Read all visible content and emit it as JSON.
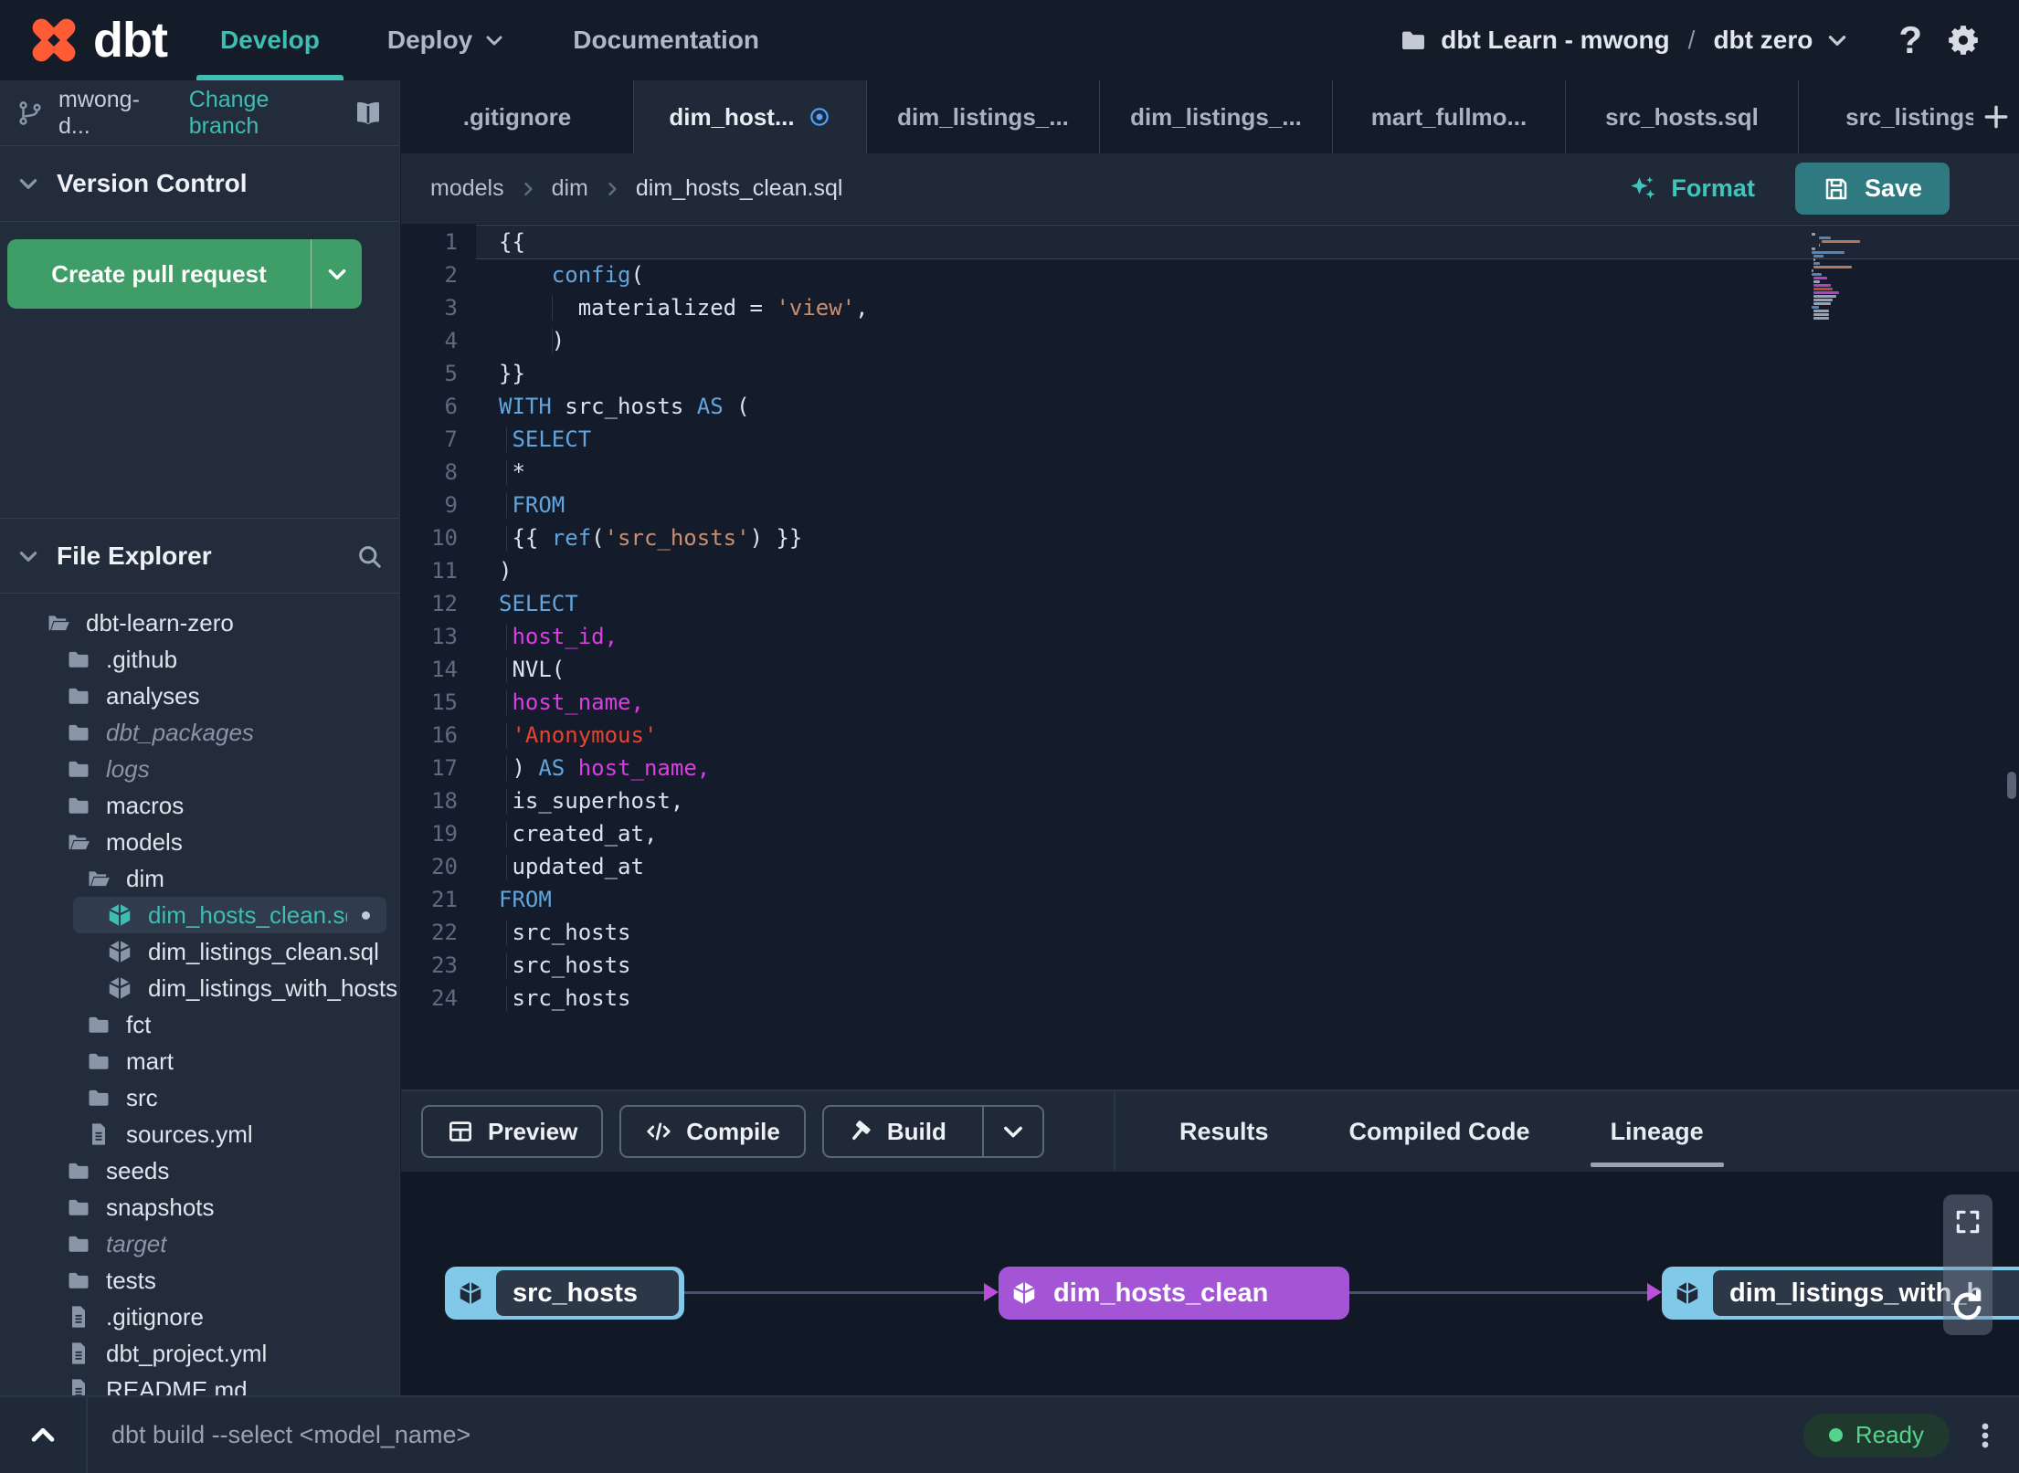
{
  "colors": {
    "accent_teal": "#3fbdb2",
    "teal_bright": "#3fc6bc",
    "create_pr_green": "#3f9e67",
    "save_teal": "#2e7a80",
    "node_purple": "#a355d6",
    "node_blue": "#82c8e8",
    "status_green": "#55d38a",
    "modified_dot_blue": "#4da3ff",
    "logo_orange": "#ff5c35"
  },
  "navbar": {
    "logo_text": "dbt",
    "links": {
      "develop": "Develop",
      "deploy": "Deploy",
      "documentation": "Documentation"
    },
    "project": {
      "account": "dbt Learn - mwong",
      "separator": "/",
      "name": "dbt zero"
    }
  },
  "sidebar": {
    "branch": {
      "name": "mwong-d...",
      "change_label": "Change branch"
    },
    "version_control": {
      "title": "Version Control",
      "create_pr": "Create pull request"
    },
    "file_explorer": {
      "title": "File Explorer",
      "tree": [
        {
          "label": "dbt-learn-zero",
          "icon": "folder-open",
          "level": 0
        },
        {
          "label": ".github",
          "icon": "folder",
          "level": 1
        },
        {
          "label": "analyses",
          "icon": "folder",
          "level": 1
        },
        {
          "label": "dbt_packages",
          "icon": "folder",
          "level": 1,
          "italic": true
        },
        {
          "label": "logs",
          "icon": "folder",
          "level": 1,
          "italic": true
        },
        {
          "label": "macros",
          "icon": "folder",
          "level": 1
        },
        {
          "label": "models",
          "icon": "folder-open",
          "level": 1
        },
        {
          "label": "dim",
          "icon": "folder-open",
          "level": 2
        },
        {
          "label": "dim_hosts_clean.sql",
          "icon": "model",
          "level": 3,
          "selected": true,
          "modified": true
        },
        {
          "label": "dim_listings_clean.sql",
          "icon": "model",
          "level": 3
        },
        {
          "label": "dim_listings_with_hosts...",
          "icon": "model",
          "level": 3
        },
        {
          "label": "fct",
          "icon": "folder",
          "level": 2
        },
        {
          "label": "mart",
          "icon": "folder",
          "level": 2
        },
        {
          "label": "src",
          "icon": "folder",
          "level": 2
        },
        {
          "label": "sources.yml",
          "icon": "file",
          "level": 2
        },
        {
          "label": "seeds",
          "icon": "folder",
          "level": 1
        },
        {
          "label": "snapshots",
          "icon": "folder",
          "level": 1
        },
        {
          "label": "target",
          "icon": "folder",
          "level": 1,
          "italic": true
        },
        {
          "label": "tests",
          "icon": "folder",
          "level": 1
        },
        {
          "label": ".gitignore",
          "icon": "file",
          "level": 1
        },
        {
          "label": "dbt_project.yml",
          "icon": "file",
          "level": 1
        },
        {
          "label": "README.md",
          "icon": "file",
          "level": 1
        }
      ]
    }
  },
  "editor": {
    "tabs": [
      {
        "label": ".gitignore"
      },
      {
        "label": "dim_host...",
        "active": true,
        "modified": true
      },
      {
        "label": "dim_listings_..."
      },
      {
        "label": "dim_listings_..."
      },
      {
        "label": "mart_fullmo..."
      },
      {
        "label": "src_hosts.sql"
      },
      {
        "label": "src_listings."
      }
    ],
    "breadcrumb": [
      "models",
      "dim",
      "dim_hosts_clean.sql"
    ],
    "format_label": "Format",
    "save_label": "Save",
    "code": [
      {
        "g": 0,
        "t": [
          [
            "{{",
            "p"
          ]
        ]
      },
      {
        "g": 0,
        "t": [
          [
            "    ",
            "p"
          ],
          [
            "config",
            "k"
          ],
          [
            "(",
            "p"
          ]
        ]
      },
      {
        "g": 58,
        "t": [
          [
            "      materialized = ",
            "p"
          ],
          [
            "'view'",
            "s"
          ],
          [
            ",",
            "p"
          ]
        ]
      },
      {
        "g": 58,
        "t": [
          [
            "    )",
            "p"
          ]
        ]
      },
      {
        "g": 0,
        "t": [
          [
            "}}",
            "p"
          ]
        ]
      },
      {
        "g": 0,
        "t": [
          [
            "WITH",
            "k"
          ],
          [
            " src_hosts ",
            "p"
          ],
          [
            "AS",
            "k"
          ],
          [
            " (",
            "p"
          ]
        ]
      },
      {
        "g": 8,
        "t": [
          [
            " ",
            "p"
          ],
          [
            "SELECT",
            "k"
          ]
        ]
      },
      {
        "g": 8,
        "t": [
          [
            " *",
            "p"
          ]
        ]
      },
      {
        "g": 8,
        "t": [
          [
            " ",
            "p"
          ],
          [
            "FROM",
            "k"
          ]
        ]
      },
      {
        "g": 8,
        "t": [
          [
            " {{ ",
            "p"
          ],
          [
            "ref",
            "k"
          ],
          [
            "(",
            "p"
          ],
          [
            "'src_hosts'",
            "s"
          ],
          [
            ") }}",
            "p"
          ]
        ]
      },
      {
        "g": 0,
        "t": [
          [
            ")",
            "p"
          ]
        ]
      },
      {
        "g": 0,
        "t": [
          [
            "SELECT",
            "k"
          ]
        ]
      },
      {
        "g": 8,
        "t": [
          [
            " ",
            "p"
          ],
          [
            "host_id,",
            "m"
          ]
        ]
      },
      {
        "g": 8,
        "t": [
          [
            " NVL(",
            "p"
          ]
        ]
      },
      {
        "g": 8,
        "t": [
          [
            " ",
            "p"
          ],
          [
            "host_name,",
            "m"
          ]
        ]
      },
      {
        "g": 8,
        "t": [
          [
            " ",
            "p"
          ],
          [
            "'Anonymous'",
            "r"
          ]
        ]
      },
      {
        "g": 8,
        "t": [
          [
            " ) ",
            "p"
          ],
          [
            "AS",
            "k"
          ],
          [
            " ",
            "p"
          ],
          [
            "host_name,",
            "m"
          ]
        ]
      },
      {
        "g": 8,
        "t": [
          [
            " is_superhost,",
            "p"
          ]
        ]
      },
      {
        "g": 8,
        "t": [
          [
            " created_at,",
            "p"
          ]
        ]
      },
      {
        "g": 8,
        "t": [
          [
            " updated_at",
            "p"
          ]
        ]
      },
      {
        "g": 0,
        "t": [
          [
            "FROM",
            "k"
          ]
        ]
      },
      {
        "g": 8,
        "t": [
          [
            " src_hosts",
            "p"
          ]
        ]
      },
      {
        "g": 8,
        "t": [
          [
            " src_hosts",
            "p"
          ]
        ]
      },
      {
        "g": 8,
        "t": [
          [
            " src_hosts",
            "p"
          ]
        ]
      }
    ]
  },
  "panel": {
    "preview_label": "Preview",
    "compile_label": "Compile",
    "build_label": "Build",
    "tabs": [
      {
        "label": "Results"
      },
      {
        "label": "Compiled Code"
      },
      {
        "label": "Lineage",
        "active": true
      }
    ],
    "lineage_nodes": [
      {
        "label": "src_hosts",
        "kind": "default"
      },
      {
        "label": "dim_hosts_clean",
        "kind": "current"
      },
      {
        "label": "dim_listings_with_h",
        "kind": "default"
      }
    ]
  },
  "statusbar": {
    "command": "dbt build --select <model_name>",
    "status_label": "Ready"
  }
}
